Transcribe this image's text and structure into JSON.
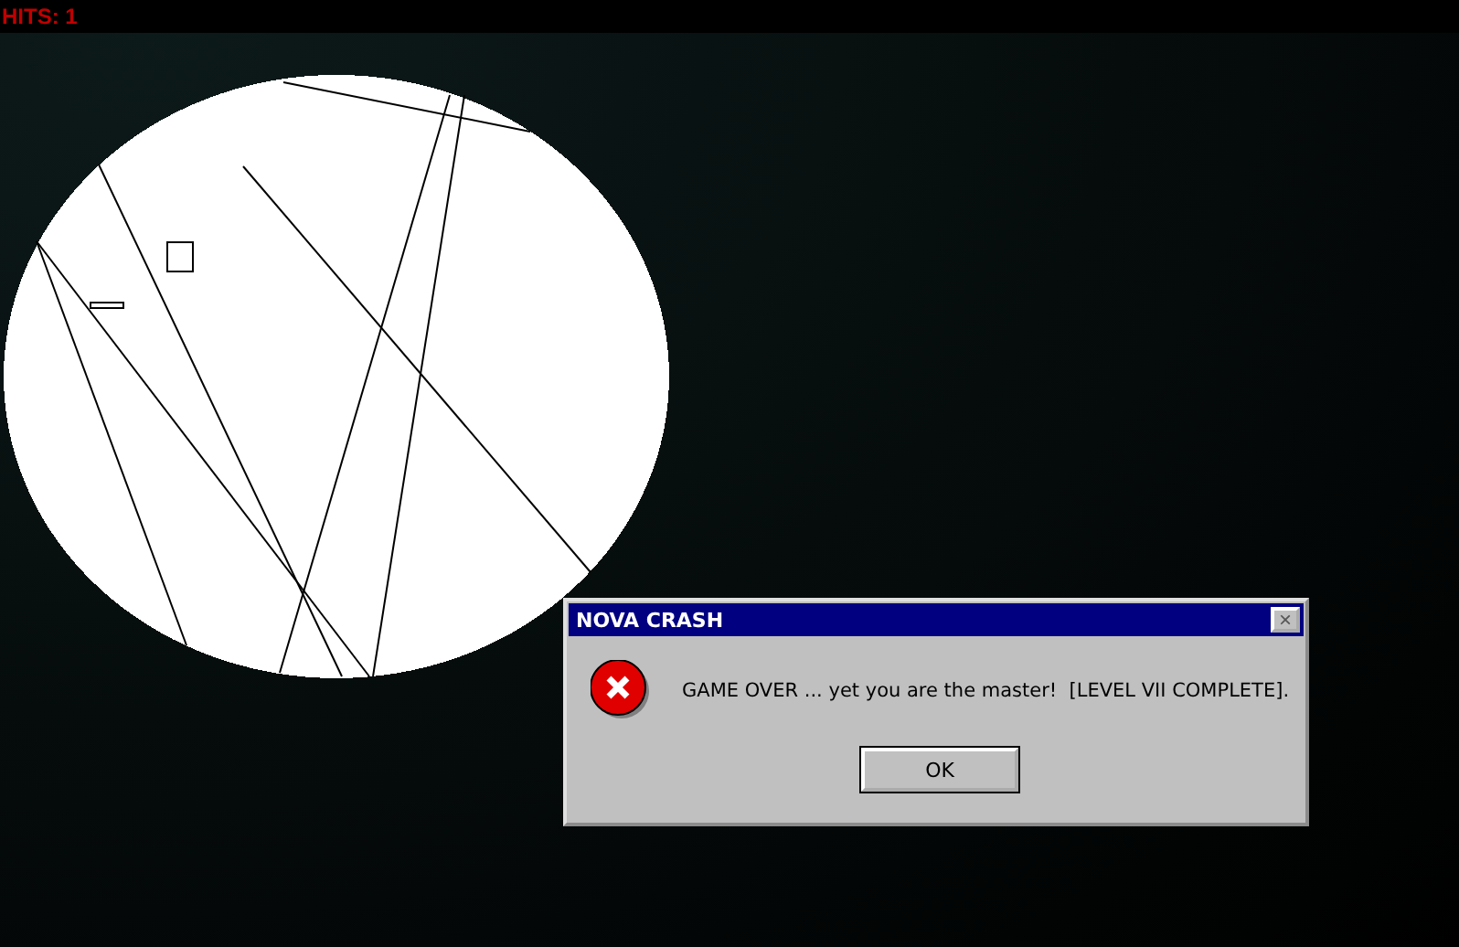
{
  "hud": {
    "hits": "HITS: 1"
  },
  "dialog": {
    "title": "NOVA CRASH",
    "close": "×",
    "message": "GAME OVER ... yet you are the master!  [LEVEL VII COMPLETE].",
    "buttons": [
      "OK"
    ]
  }
}
